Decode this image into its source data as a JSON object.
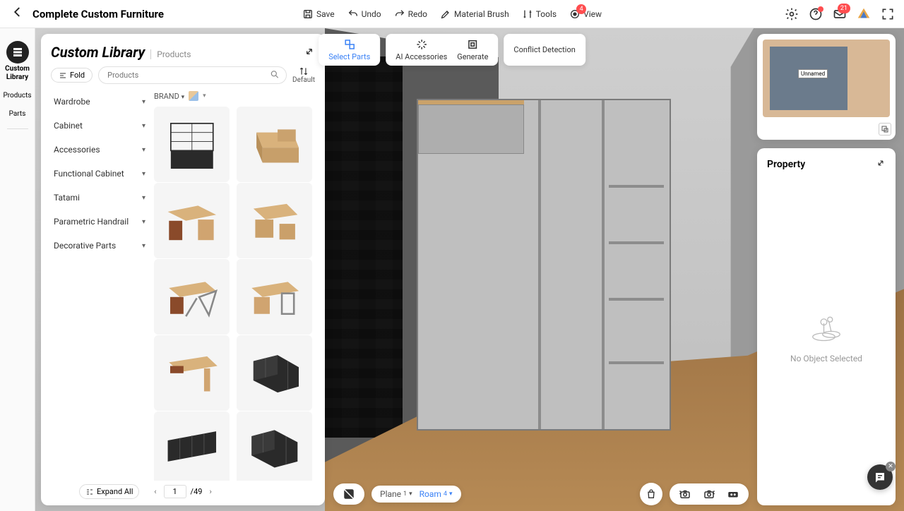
{
  "app": {
    "title": "Complete Custom Furniture"
  },
  "topTools": {
    "save": "Save",
    "undo": "Undo",
    "redo": "Redo",
    "materialBrush": "Material Brush",
    "tools": "Tools",
    "view": "View",
    "viewBadge": "4"
  },
  "topRight": {
    "mailBadge": "21"
  },
  "rail": {
    "customLibrary": "Custom Library",
    "products": "Products",
    "parts": "Parts"
  },
  "library": {
    "title": "Custom Library",
    "crumb": "Products",
    "fold": "Fold",
    "searchPlaceholder": "Products",
    "sort": "Default",
    "brandLabel": "BRAND",
    "expandAll": "Expand All",
    "categories": [
      "Wardrobe",
      "Cabinet",
      "Accessories",
      "Functional Cabinet",
      "Tatami",
      "Parametric Handrail",
      "Decorative Parts"
    ],
    "page": "1",
    "totalPages": "49"
  },
  "actions": {
    "selectParts": "Select Parts",
    "aiAccessories": "AI Accessories",
    "generate": "Generate",
    "conflictDetection": "Conflict Detection"
  },
  "minimap": {
    "roomLabel": "Unnamed"
  },
  "property": {
    "title": "Property",
    "empty": "No Object Selected"
  },
  "bottom": {
    "plane": "Plane",
    "planeNum": "1",
    "roam": "Roam",
    "roamNum": "4"
  }
}
